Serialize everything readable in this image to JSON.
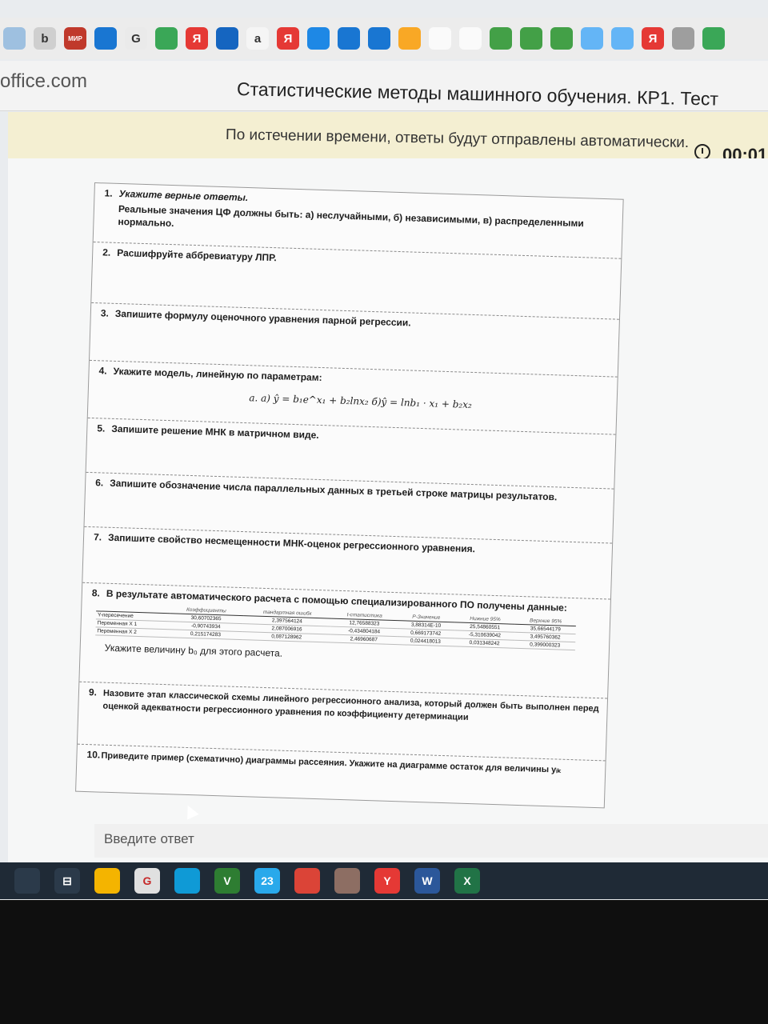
{
  "browser": {
    "domain": "office.com",
    "bookmarks": [
      {
        "icon": "blank-icon",
        "color": "#9ec0e0",
        "text": ""
      },
      {
        "icon": "bing-icon",
        "color": "#cfcfcf",
        "text": "b"
      },
      {
        "icon": "mir-icon",
        "color": "#c0392b",
        "text": "МИР"
      },
      {
        "icon": "edge-icon",
        "color": "#1976d2",
        "text": ""
      },
      {
        "icon": "chrome-icon",
        "color": "#eaeaea",
        "text": "G"
      },
      {
        "icon": "drive-icon",
        "color": "#3aa757",
        "text": ""
      },
      {
        "icon": "yandex-icon",
        "color": "#e53935",
        "text": "Я"
      },
      {
        "icon": "note-icon",
        "color": "#1565c0",
        "text": ""
      },
      {
        "icon": "amazon-icon",
        "color": "#f5f5f5",
        "text": "a"
      },
      {
        "icon": "yandex-icon",
        "color": "#e53935",
        "text": "Я"
      },
      {
        "icon": "tile-icon",
        "color": "#1e88e5",
        "text": ""
      },
      {
        "icon": "edge-icon",
        "color": "#1976d2",
        "text": ""
      },
      {
        "icon": "edge-icon",
        "color": "#1976d2",
        "text": ""
      },
      {
        "icon": "image-icon",
        "color": "#f9a825",
        "text": ""
      },
      {
        "icon": "doc-icon",
        "color": "#fafafa",
        "text": ""
      },
      {
        "icon": "doc-icon",
        "color": "#fafafa",
        "text": ""
      },
      {
        "icon": "apps-icon",
        "color": "#43a047",
        "text": ""
      },
      {
        "icon": "apps-icon",
        "color": "#43a047",
        "text": ""
      },
      {
        "icon": "apps-icon",
        "color": "#43a047",
        "text": ""
      },
      {
        "icon": "pin-icon",
        "color": "#64b5f6",
        "text": ""
      },
      {
        "icon": "pin-icon",
        "color": "#64b5f6",
        "text": ""
      },
      {
        "icon": "yandex-icon",
        "color": "#e53935",
        "text": "Я"
      },
      {
        "icon": "circle-icon",
        "color": "#9e9e9e",
        "text": ""
      },
      {
        "icon": "drive-icon",
        "color": "#3aa757",
        "text": ""
      }
    ]
  },
  "page": {
    "title": "Статистические методы машинного обучения. КР1. Тест",
    "notice": "По истечении времени, ответы будут отправлены автоматически.",
    "timer": "00:01"
  },
  "questions": {
    "q1": {
      "num": "1.",
      "title": "Укажите верные ответы.",
      "body": "Реальные значения ЦФ должны быть: а) неслучайными, б) независимыми, в) распределенными нормально."
    },
    "q2": {
      "num": "2.",
      "text": "Расшифруйте аббревиатуру ЛПР."
    },
    "q3": {
      "num": "3.",
      "text": "Запишите формулу оценочного уравнения парной регрессии."
    },
    "q4": {
      "num": "4.",
      "text": "Укажите модель, линейную по параметрам:",
      "formula": "a.  а) ŷ = b₁e^x₁ + b₂lnx₂     б)ŷ = lnb₁ · x₁ + b₂x₂"
    },
    "q5": {
      "num": "5.",
      "text": "Запишите решение МНК в матричном виде."
    },
    "q6": {
      "num": "6.",
      "text": "Запишите обозначение числа параллельных данных в третьей строке матрицы результатов."
    },
    "q7": {
      "num": "7.",
      "text": "Запишите свойство несмещенности МНК-оценок регрессионного уравнения."
    },
    "q8": {
      "num": "8.",
      "text": "В результате автоматического расчета с помощью специализированного ПО получены данные:",
      "headers": [
        "",
        "Коэффициенты",
        "тандартная ошибк",
        "t-статистика",
        "P-Значение",
        "Нижние 95%",
        "Верхние 95%"
      ],
      "rows": [
        [
          "Y-пересечение",
          "30,60702365",
          "2,397564124",
          "12,76588323",
          "3,88314E-10",
          "25,54860551",
          "35,66544179"
        ],
        [
          "Переменная X 1",
          "-0,90743934",
          "2,087006916",
          "-0,434804184",
          "0,669173742",
          "-5,310639042",
          "3,495760362"
        ],
        [
          "Переменная X 2",
          "0,215174283",
          "0,087128962",
          "2,46960687",
          "0,024418013",
          "0,031348242",
          "0,399000323"
        ]
      ],
      "sub": "Укажите величину b₀ для этого расчета."
    },
    "q9": {
      "num": "9.",
      "text": "Назовите этап классической схемы линейного регрессионного анализа, который должен быть выполнен перед оценкой адекватности регрессионного уравнения по коэффициенту детерминации"
    },
    "q10": {
      "num": "10.",
      "text": "Приведите пример (схематично) диаграммы рассеяния. Укажите на диаграмме остаток для величины yᵢₖ"
    }
  },
  "answer": {
    "placeholder": "Введите ответ"
  },
  "taskbar": [
    {
      "icon": "start-icon",
      "color": "#2b3a4a",
      "text": ""
    },
    {
      "icon": "taskview-icon",
      "color": "#2b3a4a",
      "text": "⊟"
    },
    {
      "icon": "explorer-icon",
      "color": "#f4b400",
      "text": ""
    },
    {
      "icon": "settings-icon",
      "color": "#e0e0e0",
      "text": "G"
    },
    {
      "icon": "edge-icon",
      "color": "#0f9ad6",
      "text": ""
    },
    {
      "icon": "vs-icon",
      "color": "#2e7d32",
      "text": "V"
    },
    {
      "icon": "telegram-icon",
      "color": "#29a9eb",
      "text": "23"
    },
    {
      "icon": "chrome-icon",
      "color": "#db4437",
      "text": ""
    },
    {
      "icon": "owl-icon",
      "color": "#8d6e63",
      "text": ""
    },
    {
      "icon": "yandex-browser-icon",
      "color": "#e53935",
      "text": "Y"
    },
    {
      "icon": "word-icon",
      "color": "#2b579a",
      "text": "W"
    },
    {
      "icon": "excel-icon",
      "color": "#217346",
      "text": "X"
    }
  ]
}
